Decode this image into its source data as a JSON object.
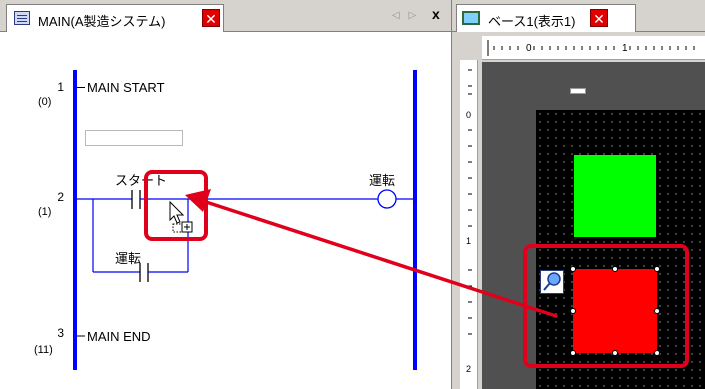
{
  "ladder_tab": {
    "title": "MAIN(A製造システム)",
    "nav_arrows": "◁ ▷",
    "close_glyph": "x"
  },
  "rungs": [
    {
      "number": "1",
      "step": "(0)",
      "label": "MAIN START"
    },
    {
      "number": "2",
      "step": "(1)",
      "contact_label": "スタート",
      "coil_label": "運転",
      "branch_contact_label": "運転"
    },
    {
      "number": "3",
      "step": "(11)",
      "label": "MAIN END"
    }
  ],
  "screen_tab": {
    "title": "ベース1(表示1)"
  },
  "rulers": {
    "top_marks": [
      "0",
      "1"
    ],
    "left_marks": [
      "0",
      "1",
      "2"
    ]
  },
  "colors": {
    "rail": "#0000ff",
    "highlight": "#e0001b",
    "lamp_green": "#00ff00",
    "lamp_red": "#ff0000",
    "close_red": "#e00000"
  },
  "icons": {
    "tab_ladder": "ladder-sheet-icon",
    "tab_screen": "screen-base-icon",
    "cursor": "drag-copy-cursor-icon",
    "lamp_part": "magnifier-pin-icon"
  }
}
